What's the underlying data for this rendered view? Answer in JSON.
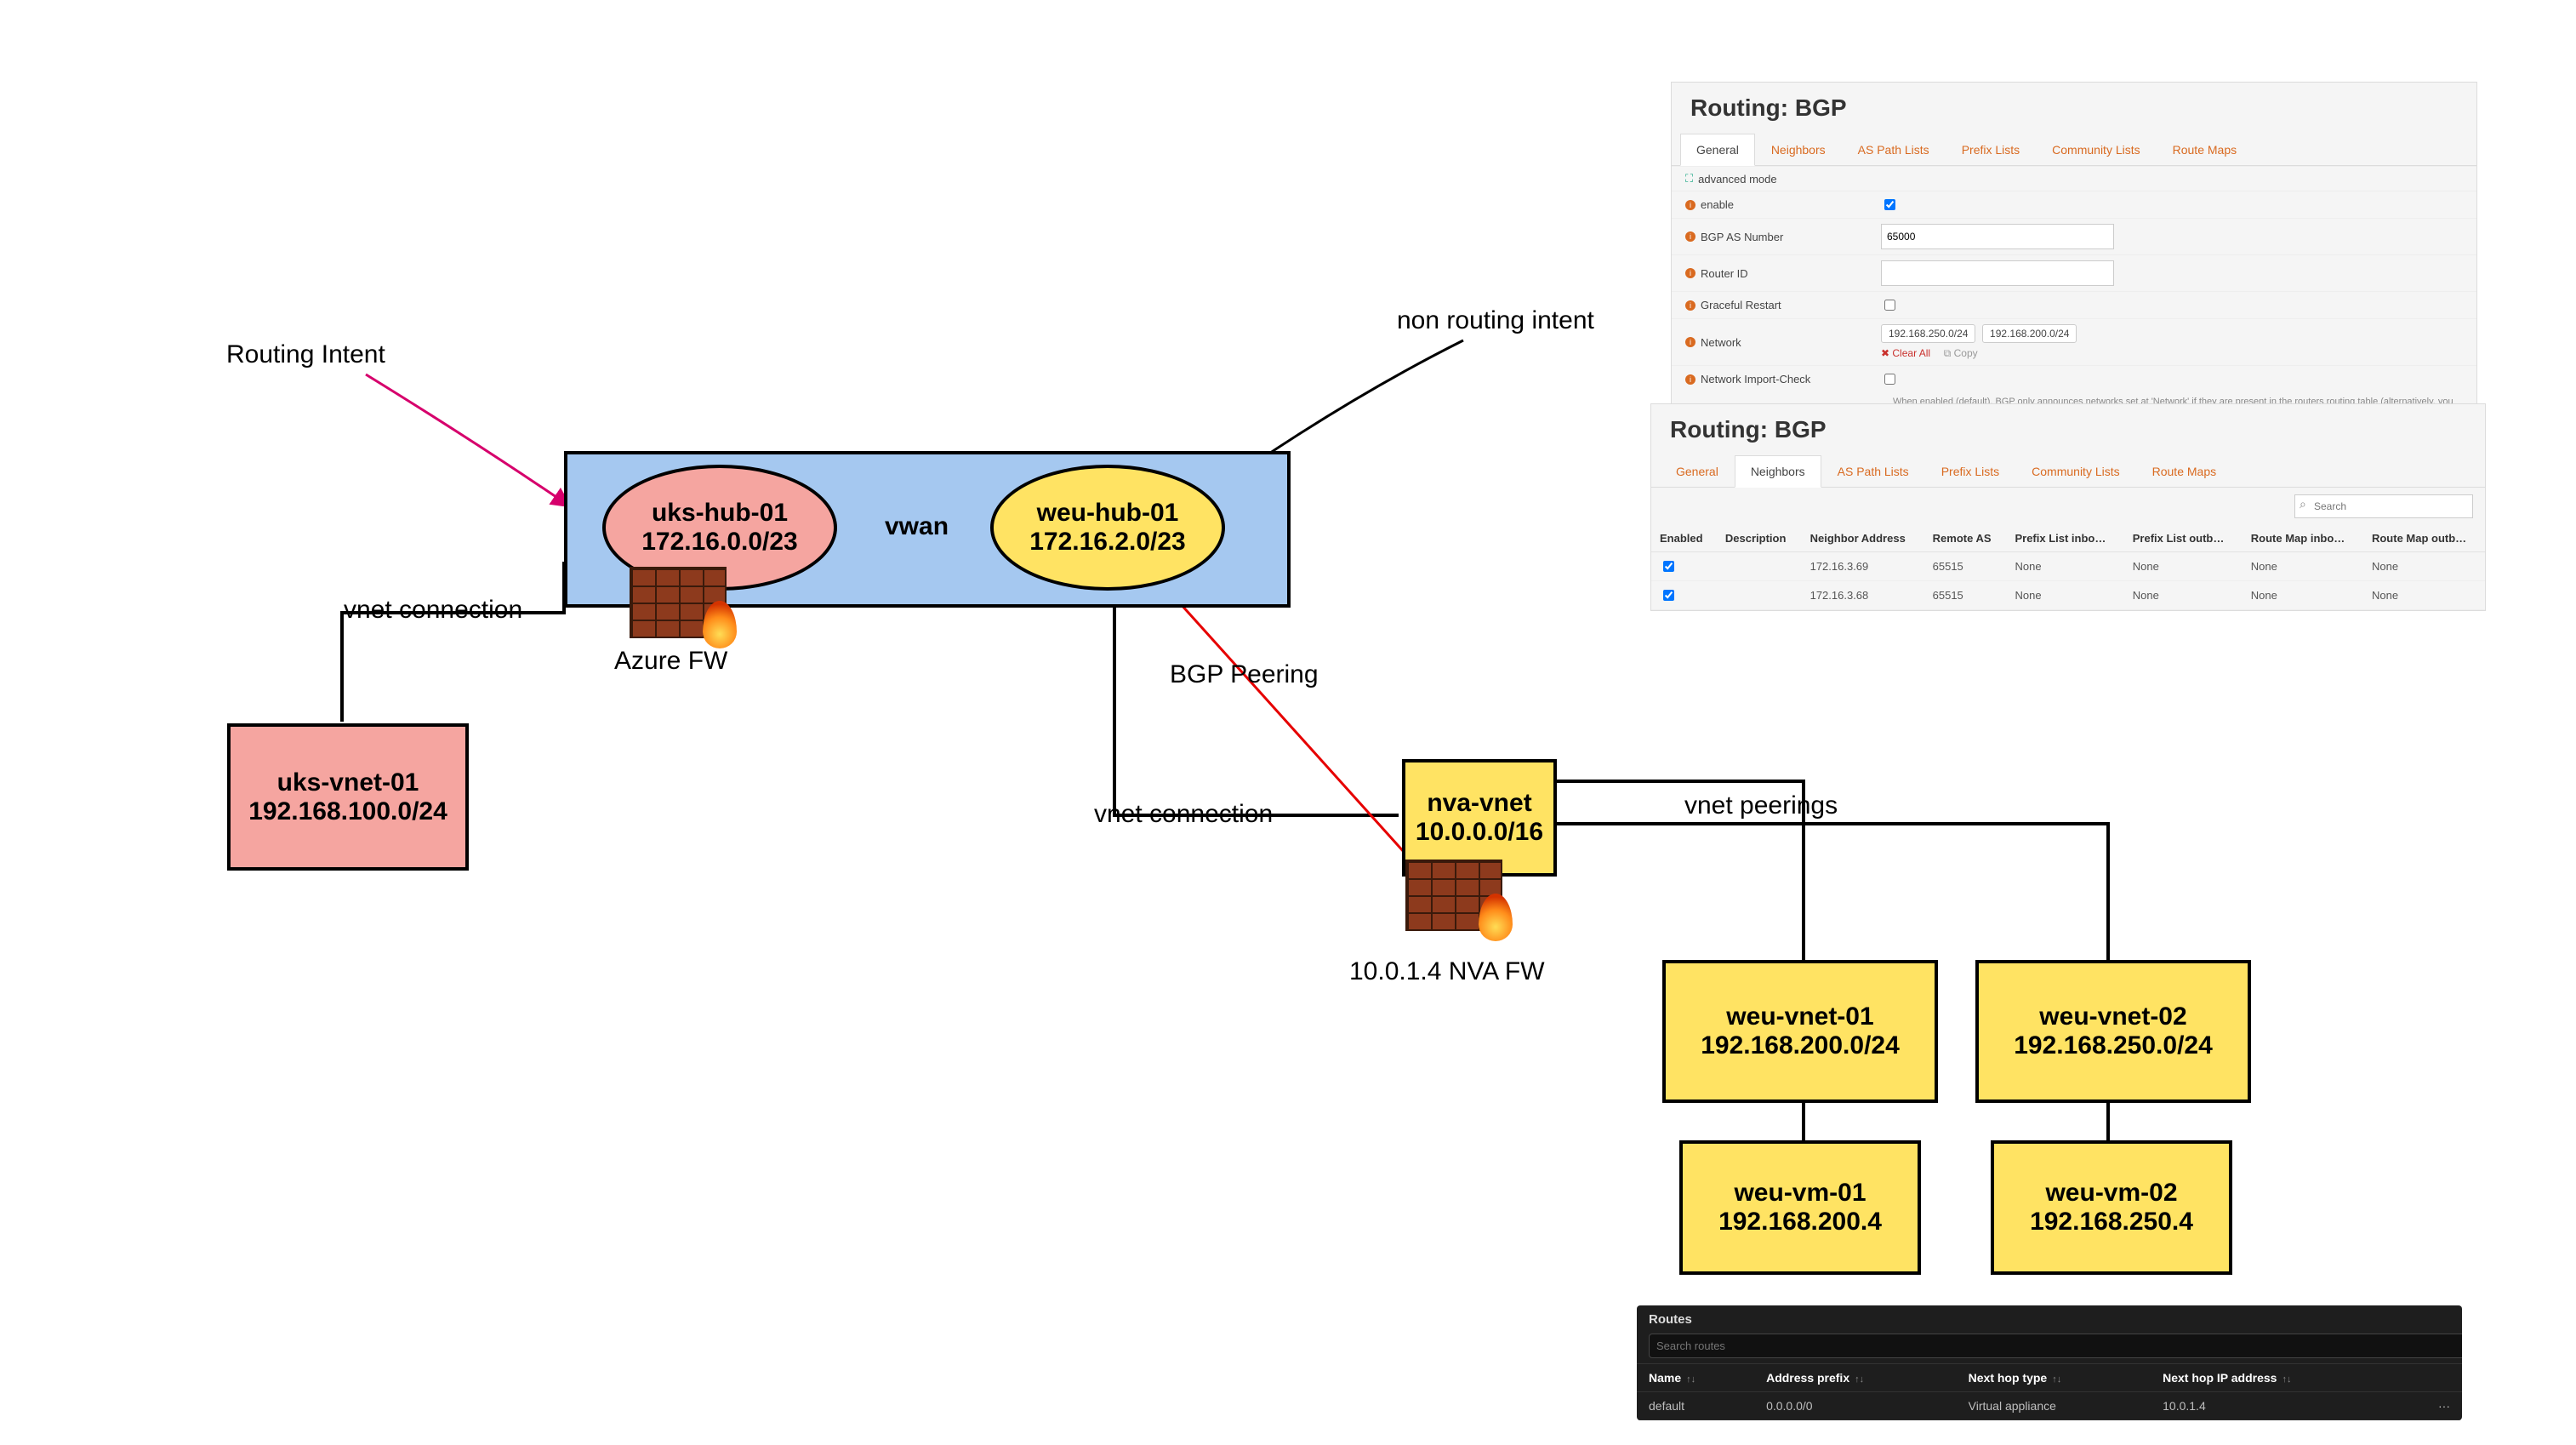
{
  "labels": {
    "routing_intent": "Routing Intent",
    "non_routing_intent": "non routing intent",
    "vnet_connection": "vnet connection",
    "azure_fw": "Azure FW",
    "bgp_peering": "BGP Peering",
    "vnet_peerings": "vnet peerings",
    "vwan": "vwan",
    "nva_fw": "10.0.1.4 NVA FW"
  },
  "hubs": {
    "uks": {
      "name": "uks-hub-01",
      "cidr": "172.16.0.0/23"
    },
    "weu": {
      "name": "weu-hub-01",
      "cidr": "172.16.2.0/23"
    }
  },
  "vnets": {
    "uks": {
      "name": "uks-vnet-01",
      "cidr": "192.168.100.0/24"
    },
    "nva": {
      "name": "nva-vnet",
      "cidr": "10.0.0.0/16"
    },
    "weu1": {
      "name": "weu-vnet-01",
      "cidr": "192.168.200.0/24"
    },
    "weu2": {
      "name": "weu-vnet-02",
      "cidr": "192.168.250.0/24"
    }
  },
  "vms": {
    "weu1": {
      "name": "weu-vm-01",
      "ip": "192.168.200.4"
    },
    "weu2": {
      "name": "weu-vm-02",
      "ip": "192.168.250.4"
    }
  },
  "bgp_general": {
    "title": "Routing: BGP",
    "tabs": [
      "General",
      "Neighbors",
      "AS Path Lists",
      "Prefix Lists",
      "Community Lists",
      "Route Maps"
    ],
    "active_tab": "General",
    "rows": {
      "advanced_mode": "advanced mode",
      "enable": "enable",
      "as_number": "BGP AS Number",
      "as_value": "65000",
      "router_id": "Router ID",
      "graceful": "Graceful Restart",
      "network": "Network",
      "networks": [
        "192.168.250.0/24",
        "192.168.200.0/24"
      ],
      "clear_all": "Clear All",
      "copy": "Copy",
      "import_check": "Network Import-Check",
      "import_help": "When enabled (default), BGP only announces networks set at 'Network' if they are present in the routers routing table (alternatively, you can also set a null-route via System → Routes). If disabled, all configured networks will be announced."
    }
  },
  "bgp_neighbors": {
    "title": "Routing: BGP",
    "tabs": [
      "General",
      "Neighbors",
      "AS Path Lists",
      "Prefix Lists",
      "Community Lists",
      "Route Maps"
    ],
    "active_tab": "Neighbors",
    "search_placeholder": "Search",
    "headers": [
      "Enabled",
      "Description",
      "Neighbor Address",
      "Remote AS",
      "Prefix List inbo…",
      "Prefix List outb…",
      "Route Map inbo…",
      "Route Map outb…"
    ],
    "rows": [
      {
        "enabled": true,
        "desc": "",
        "addr": "172.16.3.69",
        "as": "65515",
        "pli": "None",
        "plo": "None",
        "rmi": "None",
        "rmo": "None"
      },
      {
        "enabled": true,
        "desc": "",
        "addr": "172.16.3.68",
        "as": "65515",
        "pli": "None",
        "plo": "None",
        "rmi": "None",
        "rmo": "None"
      }
    ]
  },
  "routes": {
    "title": "Routes",
    "search_placeholder": "Search routes",
    "headers": [
      "Name",
      "Address prefix",
      "Next hop type",
      "Next hop IP address"
    ],
    "row": {
      "name": "default",
      "prefix": "0.0.0.0/0",
      "type": "Virtual appliance",
      "ip": "10.0.1.4"
    }
  }
}
